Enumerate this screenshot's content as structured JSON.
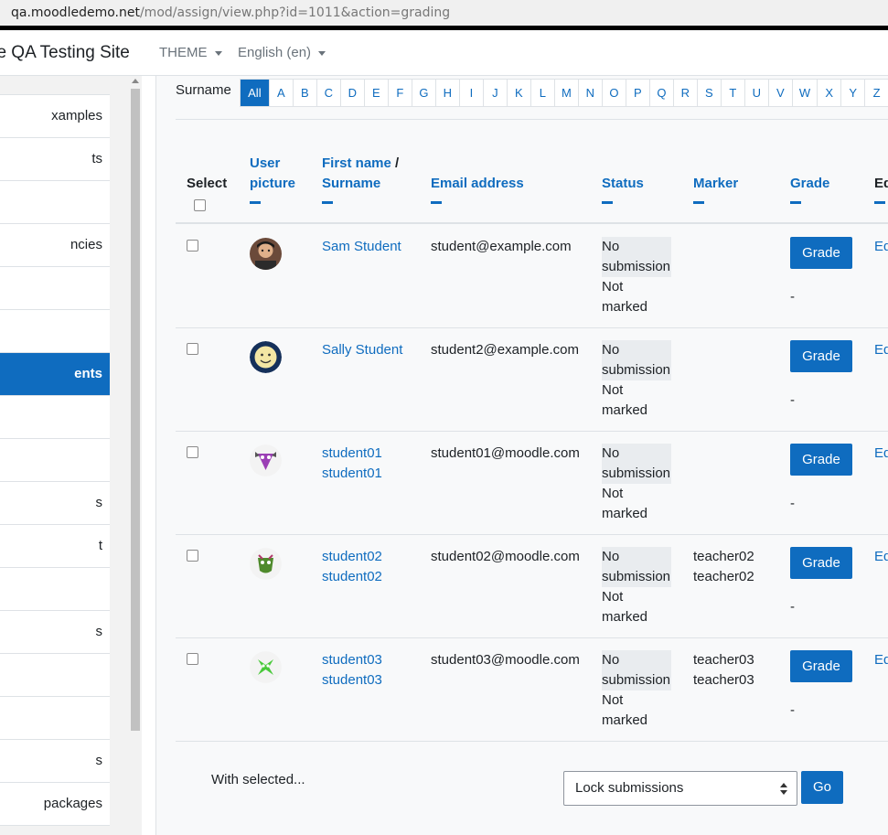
{
  "browser": {
    "url_host": "qa.moodledemo.net",
    "url_path": "/mod/assign/view.php?id=1011&action=grading"
  },
  "navbar": {
    "site_name": "lle QA Testing Site",
    "theme_label": "THEME",
    "lang_label": "English (en)"
  },
  "drawer": {
    "items": [
      {
        "label": "xamples",
        "active": false
      },
      {
        "label": "ts",
        "active": false
      },
      {
        "label": "",
        "active": false
      },
      {
        "label": "ncies",
        "active": false
      },
      {
        "label": "",
        "active": false
      },
      {
        "label": "",
        "active": false
      },
      {
        "label": "ents",
        "active": true
      },
      {
        "label": "",
        "active": false
      },
      {
        "label": "",
        "active": false
      },
      {
        "label": "s",
        "active": false
      },
      {
        "label": "t",
        "active": false
      },
      {
        "label": "",
        "active": false
      },
      {
        "label": "s",
        "active": false
      },
      {
        "label": "",
        "active": false
      },
      {
        "label": "",
        "active": false
      },
      {
        "label": "s",
        "active": false
      },
      {
        "label": "packages",
        "active": false
      }
    ]
  },
  "filter": {
    "label": "Surname",
    "letters": [
      "All",
      "A",
      "B",
      "C",
      "D",
      "E",
      "F",
      "G",
      "H",
      "I",
      "J",
      "K",
      "L",
      "M",
      "N",
      "O",
      "P",
      "Q",
      "R",
      "S",
      "T",
      "U",
      "V",
      "W",
      "X",
      "Y",
      "Z"
    ],
    "active": "All"
  },
  "table": {
    "headers": {
      "select": "Select",
      "picture_1": "User",
      "picture_2": "picture",
      "firstname": "First name",
      "slash": " /",
      "surname": "Surname",
      "email": "Email address",
      "status": "Status",
      "marker": "Marker",
      "grade": "Grade",
      "edit": "Ed"
    },
    "rows": [
      {
        "name1": "Sam Student",
        "name2": "",
        "email": "student@example.com",
        "status_sub1": "No",
        "status_sub2": "submission",
        "status_mark1": "Not",
        "status_mark2": "marked",
        "marker1": "",
        "marker2": "",
        "grade_btn": "Grade",
        "grade_val": "-",
        "edit": "Ed",
        "avatar": "photo"
      },
      {
        "name1": "Sally Student",
        "name2": "",
        "email": "student2@example.com",
        "status_sub1": "No",
        "status_sub2": "submission",
        "status_mark1": "Not",
        "status_mark2": "marked",
        "marker1": "",
        "marker2": "",
        "grade_btn": "Grade",
        "grade_val": "-",
        "edit": "Ed",
        "avatar": "smiley"
      },
      {
        "name1": "student01",
        "name2": "student01",
        "email": "student01@moodle.com",
        "status_sub1": "No",
        "status_sub2": "submission",
        "status_mark1": "Not",
        "status_mark2": "marked",
        "marker1": "",
        "marker2": "",
        "grade_btn": "Grade",
        "grade_val": "-",
        "edit": "Ed",
        "avatar": "monster-purple"
      },
      {
        "name1": "student02",
        "name2": "student02",
        "email": "student02@moodle.com",
        "status_sub1": "No",
        "status_sub2": "submission",
        "status_mark1": "Not",
        "status_mark2": "marked",
        "marker1": "teacher02",
        "marker2": "teacher02",
        "grade_btn": "Grade",
        "grade_val": "-",
        "edit": "Ed",
        "avatar": "monster-green"
      },
      {
        "name1": "student03",
        "name2": "student03",
        "email": "student03@moodle.com",
        "status_sub1": "No",
        "status_sub2": "submission",
        "status_mark1": "Not",
        "status_mark2": "marked",
        "marker1": "teacher03",
        "marker2": "teacher03",
        "grade_btn": "Grade",
        "grade_val": "-",
        "edit": "Ed",
        "avatar": "monster-lime"
      }
    ]
  },
  "bulk": {
    "label": "With selected...",
    "selected_option": "Lock submissions",
    "go_label": "Go"
  },
  "colors": {
    "primary": "#0f6cbf",
    "active_bg": "#0f6cbf",
    "badge_bg": "#e9ecef"
  }
}
